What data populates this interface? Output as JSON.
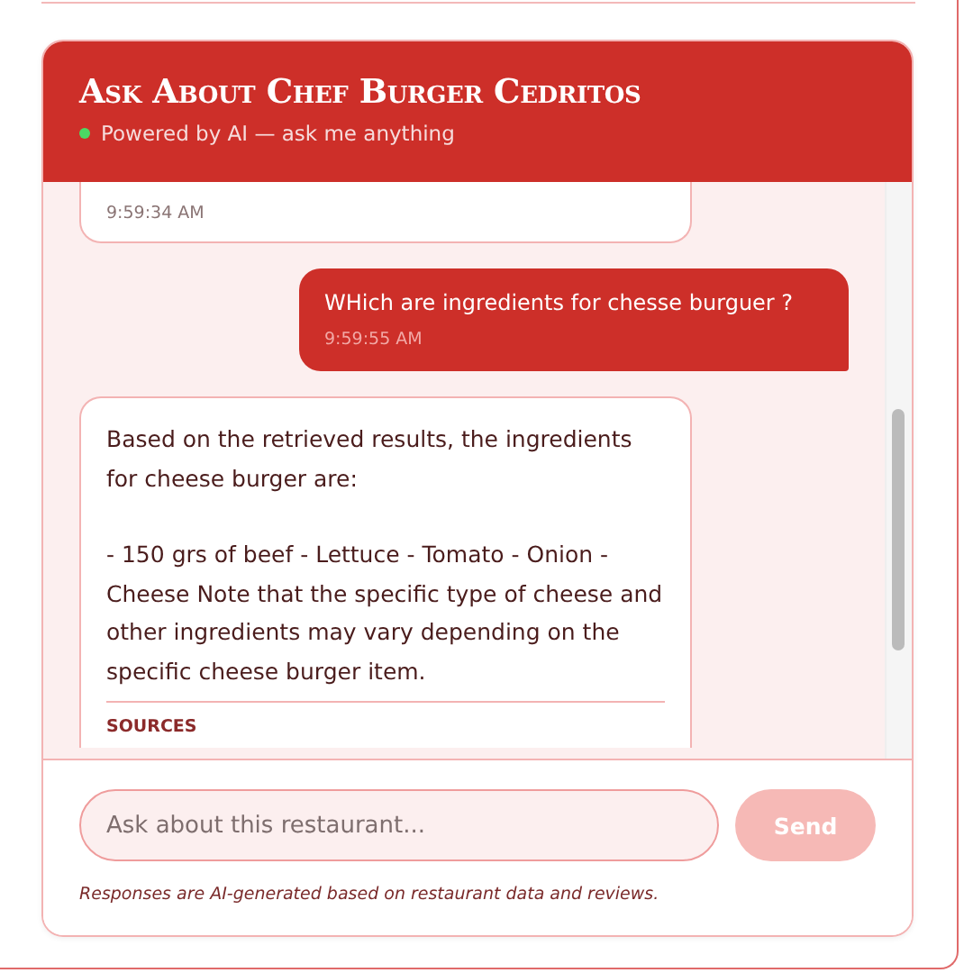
{
  "chat": {
    "title": "Ask About Chef Burger Cedritos",
    "status": {
      "online": true,
      "text": "Powered by AI — ask me anything"
    },
    "messages": [
      {
        "kind": "assistant",
        "time": "9:59:34 AM"
      },
      {
        "kind": "user",
        "text": "WHich are ingredients for chesse burguer ?",
        "time": "9:59:55 AM"
      },
      {
        "kind": "assistant",
        "paragraphs": [
          "Based on the retrieved results, the ingredients for cheese burger are:",
          "- 150 grs of beef - Lettuce - Tomato - Onion - Cheese Note that the specific type of cheese and other ingredients may vary depending on the specific cheese burger item."
        ],
        "sources_label": "SOURCES"
      }
    ],
    "input": {
      "placeholder": "Ask about this restaurant..."
    },
    "send_button": {
      "label": "Send",
      "disabled": true
    },
    "disclaimer": "Responses are AI-generated based on restaurant data and reviews."
  }
}
